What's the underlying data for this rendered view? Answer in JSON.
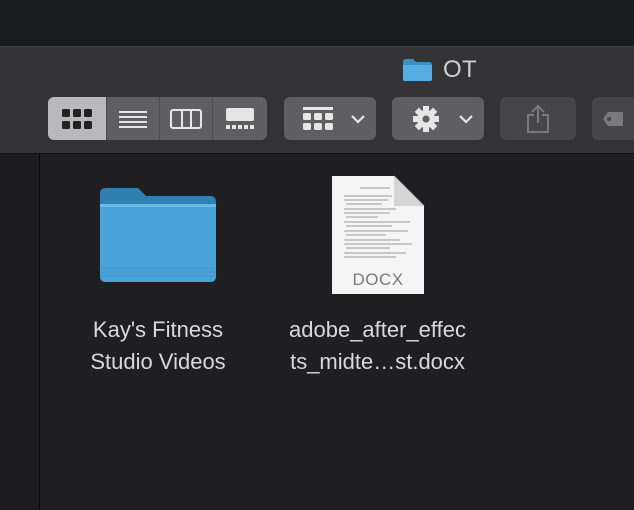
{
  "window": {
    "title": "OT"
  },
  "icons": {
    "folder": "folder-icon",
    "icon_view": "icon-view-icon",
    "list_view": "list-view-icon",
    "column_view": "column-view-icon",
    "gallery_view": "gallery-view-icon",
    "group": "group-icon",
    "action": "gear-icon",
    "share": "share-icon",
    "tags": "tag-icon"
  },
  "toolbar": {
    "view_mode_selected": "icon"
  },
  "files": [
    {
      "name_line1": "Kay's Fitness",
      "name_line2": "Studio Videos",
      "kind": "folder"
    },
    {
      "name_line1": "adobe_after_effec",
      "name_line2": "ts_midte…st.docx",
      "kind": "document",
      "badge": "DOCX"
    }
  ],
  "colors": {
    "folder": "#4aa3d8",
    "selected_segment": "#b9b9bb",
    "button": "#5f5f61",
    "background": "#1f1f21"
  }
}
